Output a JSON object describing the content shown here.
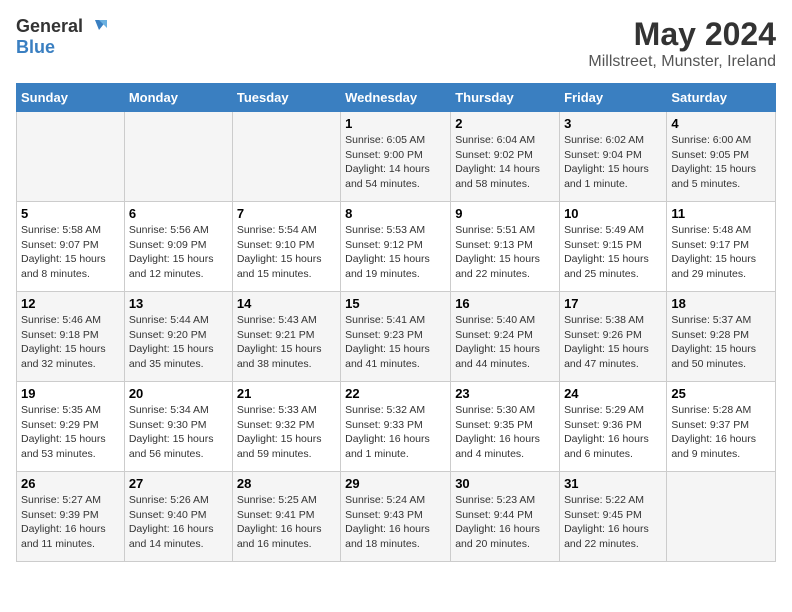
{
  "logo": {
    "line1": "General",
    "line2": "Blue"
  },
  "title": "May 2024",
  "subtitle": "Millstreet, Munster, Ireland",
  "days_of_week": [
    "Sunday",
    "Monday",
    "Tuesday",
    "Wednesday",
    "Thursday",
    "Friday",
    "Saturday"
  ],
  "weeks": [
    [
      {
        "day": "",
        "info": ""
      },
      {
        "day": "",
        "info": ""
      },
      {
        "day": "",
        "info": ""
      },
      {
        "day": "1",
        "info": "Sunrise: 6:05 AM\nSunset: 9:00 PM\nDaylight: 14 hours\nand 54 minutes."
      },
      {
        "day": "2",
        "info": "Sunrise: 6:04 AM\nSunset: 9:02 PM\nDaylight: 14 hours\nand 58 minutes."
      },
      {
        "day": "3",
        "info": "Sunrise: 6:02 AM\nSunset: 9:04 PM\nDaylight: 15 hours\nand 1 minute."
      },
      {
        "day": "4",
        "info": "Sunrise: 6:00 AM\nSunset: 9:05 PM\nDaylight: 15 hours\nand 5 minutes."
      }
    ],
    [
      {
        "day": "5",
        "info": "Sunrise: 5:58 AM\nSunset: 9:07 PM\nDaylight: 15 hours\nand 8 minutes."
      },
      {
        "day": "6",
        "info": "Sunrise: 5:56 AM\nSunset: 9:09 PM\nDaylight: 15 hours\nand 12 minutes."
      },
      {
        "day": "7",
        "info": "Sunrise: 5:54 AM\nSunset: 9:10 PM\nDaylight: 15 hours\nand 15 minutes."
      },
      {
        "day": "8",
        "info": "Sunrise: 5:53 AM\nSunset: 9:12 PM\nDaylight: 15 hours\nand 19 minutes."
      },
      {
        "day": "9",
        "info": "Sunrise: 5:51 AM\nSunset: 9:13 PM\nDaylight: 15 hours\nand 22 minutes."
      },
      {
        "day": "10",
        "info": "Sunrise: 5:49 AM\nSunset: 9:15 PM\nDaylight: 15 hours\nand 25 minutes."
      },
      {
        "day": "11",
        "info": "Sunrise: 5:48 AM\nSunset: 9:17 PM\nDaylight: 15 hours\nand 29 minutes."
      }
    ],
    [
      {
        "day": "12",
        "info": "Sunrise: 5:46 AM\nSunset: 9:18 PM\nDaylight: 15 hours\nand 32 minutes."
      },
      {
        "day": "13",
        "info": "Sunrise: 5:44 AM\nSunset: 9:20 PM\nDaylight: 15 hours\nand 35 minutes."
      },
      {
        "day": "14",
        "info": "Sunrise: 5:43 AM\nSunset: 9:21 PM\nDaylight: 15 hours\nand 38 minutes."
      },
      {
        "day": "15",
        "info": "Sunrise: 5:41 AM\nSunset: 9:23 PM\nDaylight: 15 hours\nand 41 minutes."
      },
      {
        "day": "16",
        "info": "Sunrise: 5:40 AM\nSunset: 9:24 PM\nDaylight: 15 hours\nand 44 minutes."
      },
      {
        "day": "17",
        "info": "Sunrise: 5:38 AM\nSunset: 9:26 PM\nDaylight: 15 hours\nand 47 minutes."
      },
      {
        "day": "18",
        "info": "Sunrise: 5:37 AM\nSunset: 9:28 PM\nDaylight: 15 hours\nand 50 minutes."
      }
    ],
    [
      {
        "day": "19",
        "info": "Sunrise: 5:35 AM\nSunset: 9:29 PM\nDaylight: 15 hours\nand 53 minutes."
      },
      {
        "day": "20",
        "info": "Sunrise: 5:34 AM\nSunset: 9:30 PM\nDaylight: 15 hours\nand 56 minutes."
      },
      {
        "day": "21",
        "info": "Sunrise: 5:33 AM\nSunset: 9:32 PM\nDaylight: 15 hours\nand 59 minutes."
      },
      {
        "day": "22",
        "info": "Sunrise: 5:32 AM\nSunset: 9:33 PM\nDaylight: 16 hours\nand 1 minute."
      },
      {
        "day": "23",
        "info": "Sunrise: 5:30 AM\nSunset: 9:35 PM\nDaylight: 16 hours\nand 4 minutes."
      },
      {
        "day": "24",
        "info": "Sunrise: 5:29 AM\nSunset: 9:36 PM\nDaylight: 16 hours\nand 6 minutes."
      },
      {
        "day": "25",
        "info": "Sunrise: 5:28 AM\nSunset: 9:37 PM\nDaylight: 16 hours\nand 9 minutes."
      }
    ],
    [
      {
        "day": "26",
        "info": "Sunrise: 5:27 AM\nSunset: 9:39 PM\nDaylight: 16 hours\nand 11 minutes."
      },
      {
        "day": "27",
        "info": "Sunrise: 5:26 AM\nSunset: 9:40 PM\nDaylight: 16 hours\nand 14 minutes."
      },
      {
        "day": "28",
        "info": "Sunrise: 5:25 AM\nSunset: 9:41 PM\nDaylight: 16 hours\nand 16 minutes."
      },
      {
        "day": "29",
        "info": "Sunrise: 5:24 AM\nSunset: 9:43 PM\nDaylight: 16 hours\nand 18 minutes."
      },
      {
        "day": "30",
        "info": "Sunrise: 5:23 AM\nSunset: 9:44 PM\nDaylight: 16 hours\nand 20 minutes."
      },
      {
        "day": "31",
        "info": "Sunrise: 5:22 AM\nSunset: 9:45 PM\nDaylight: 16 hours\nand 22 minutes."
      },
      {
        "day": "",
        "info": ""
      }
    ]
  ]
}
